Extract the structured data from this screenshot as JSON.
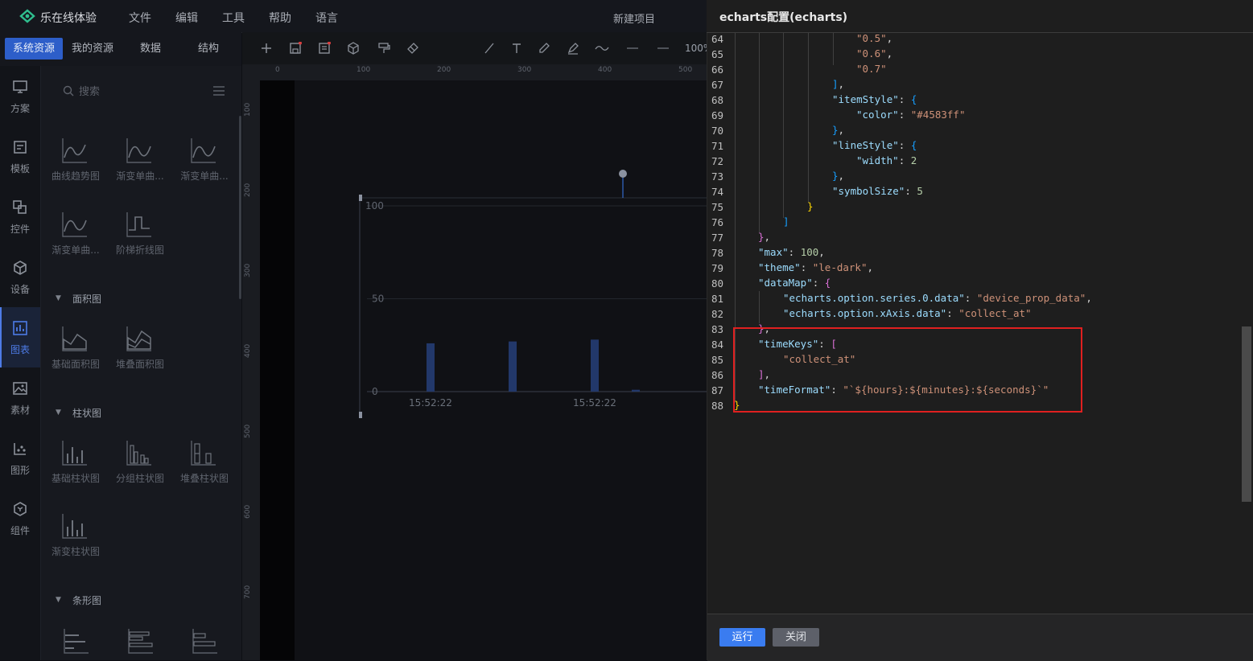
{
  "app": {
    "name": "乐在线体验",
    "project": "新建项目"
  },
  "menu": [
    "文件",
    "编辑",
    "工具",
    "帮助",
    "语言"
  ],
  "tabs": [
    "系统资源",
    "我的资源",
    "数据",
    "结构"
  ],
  "rail": [
    "方案",
    "模板",
    "控件",
    "设备",
    "图表",
    "素材",
    "图形",
    "组件"
  ],
  "search": {
    "placeholder": "搜索"
  },
  "line_items": [
    "曲线趋势图",
    "渐变单曲...",
    "渐变单曲...",
    "渐变单曲...",
    "阶梯折线图"
  ],
  "categories": {
    "area": "面积图",
    "column": "柱状图",
    "bar": "条形图"
  },
  "area_items": [
    "基础面积图",
    "堆叠面积图"
  ],
  "column_items": [
    "基础柱状图",
    "分组柱状图",
    "堆叠柱状图",
    "渐变柱状图"
  ],
  "toolbar": {
    "zoom": "100%"
  },
  "ruler": {
    "top": [
      "0",
      "100",
      "200",
      "300",
      "400",
      "500"
    ],
    "left": [
      "100",
      "200",
      "300",
      "400",
      "500",
      "600",
      "700"
    ]
  },
  "chart_data": {
    "type": "bar",
    "categories": [
      "15:52:22",
      "",
      "",
      "",
      "15:52:22",
      ""
    ],
    "values": [
      26,
      0,
      27,
      0,
      28,
      1
    ],
    "ylim": [
      0,
      100
    ],
    "yticks": [
      "0",
      "50",
      "100"
    ],
    "bar_color": "#4583ff"
  },
  "config": {
    "title": "echarts配置(echarts)",
    "run_label": "运行",
    "close_label": "关闭",
    "line_numbers": [
      "64",
      "65",
      "66",
      "67",
      "68",
      "69",
      "70",
      "71",
      "72",
      "73",
      "74",
      "75",
      "76",
      "77",
      "78",
      "79",
      "80",
      "81",
      "82",
      "83",
      "84",
      "85",
      "86",
      "87",
      "88"
    ],
    "code": {
      "s05": "\"0.5\"",
      "s06": "\"0.6\"",
      "s07": "\"0.7\"",
      "itemStyle": "\"itemStyle\"",
      "color": "\"color\"",
      "colorVal": "\"#4583ff\"",
      "lineStyle": "\"lineStyle\"",
      "width": "\"width\"",
      "widthVal": "2",
      "symbolSize": "\"symbolSize\"",
      "symbolSizeVal": "5",
      "max": "\"max\"",
      "maxVal": "100",
      "theme": "\"theme\"",
      "themeVal": "\"le-dark\"",
      "dataMap": "\"dataMap\"",
      "dm1": "\"echarts.option.series.0.data\"",
      "dm1Val": "\"device_prop_data\"",
      "dm2": "\"echarts.option.xAxis.data\"",
      "dm2Val": "\"collect_at\"",
      "timeKeys": "\"timeKeys\"",
      "collectAt": "\"collect_at\"",
      "timeFormat": "\"timeFormat\"",
      "timeFormatVal": "\"`${hours}:${minutes}:${seconds}`\""
    }
  },
  "colors": {
    "accent": "#3a7cf0",
    "highlight": "#e02020"
  }
}
